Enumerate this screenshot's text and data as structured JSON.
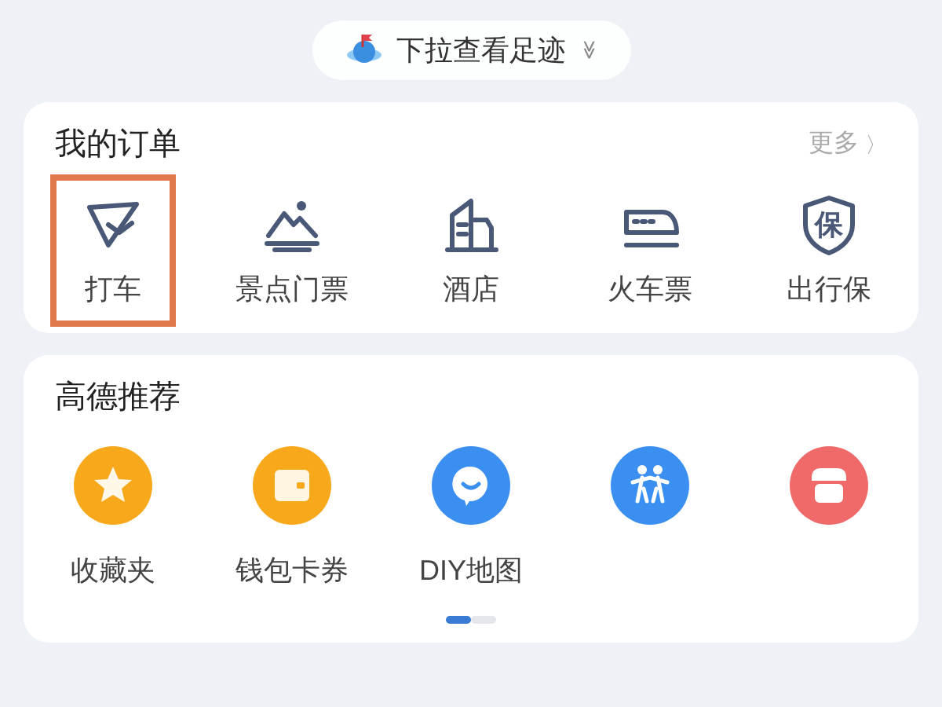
{
  "pull_hint": {
    "label": "下拉查看足迹",
    "glyph": "≫"
  },
  "orders": {
    "title": "我的订单",
    "more": "更多",
    "more_glyph": "〉",
    "items": [
      {
        "kind": "taxi",
        "label": "打车",
        "highlighted": true
      },
      {
        "kind": "scenic",
        "label": "景点门票",
        "highlighted": false
      },
      {
        "kind": "hotel",
        "label": "酒店",
        "highlighted": false
      },
      {
        "kind": "train",
        "label": "火车票",
        "highlighted": false
      },
      {
        "kind": "insurance",
        "label": "出行保",
        "glyph": "保",
        "highlighted": false
      }
    ]
  },
  "recommend": {
    "title": "高德推荐",
    "items": [
      {
        "kind": "star",
        "label": "收藏夹",
        "color": "#f7a81b"
      },
      {
        "kind": "wallet",
        "label": "钱包卡券",
        "color": "#f7a81b"
      },
      {
        "kind": "smile",
        "label": "DIY地图",
        "color": "#3b8ff0"
      },
      {
        "kind": "people",
        "color": "#3b8ff0"
      },
      {
        "kind": "shop",
        "color": "#f06a6a"
      }
    ],
    "pages": [
      {
        "selected": true
      },
      {
        "selected": false
      }
    ]
  }
}
